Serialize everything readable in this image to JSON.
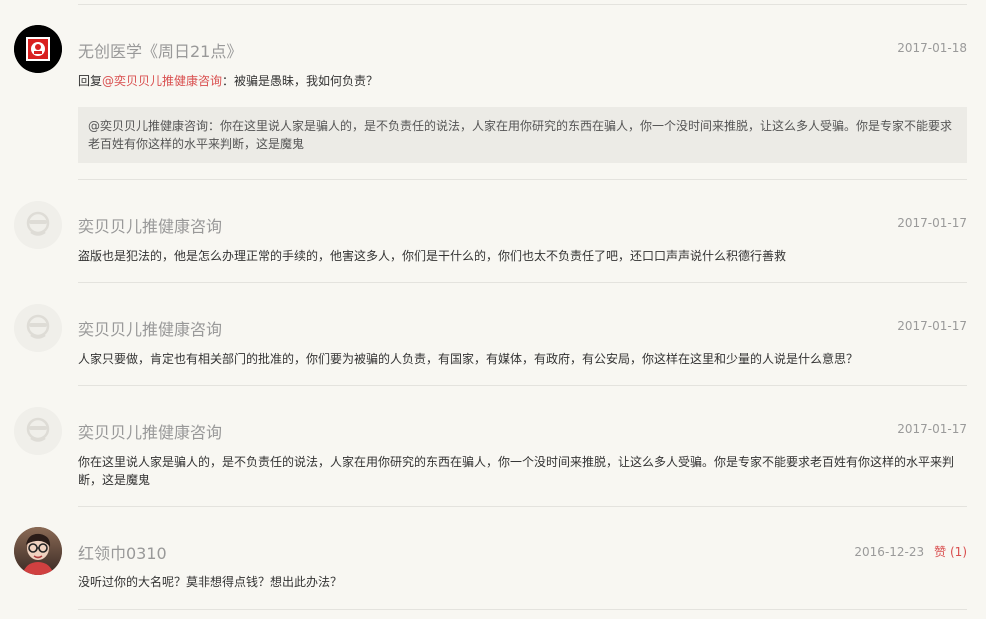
{
  "colors": {
    "background": "#f8f7f2",
    "mention": "#d94f4f",
    "muted": "#999999",
    "quote_bg": "#ecebe6"
  },
  "comments": [
    {
      "author": "无创医学《周日21点》",
      "date": "2017-01-18",
      "reply_prefix": "回复",
      "mention": "@奕贝贝儿推健康咨询",
      "reply_text": "：被骗是愚昧，我如何负责？",
      "quote": "@奕贝贝儿推健康咨询：你在这里说人家是骗人的，是不负责任的说法，人家在用你研究的东西在骗人，你一个没时间来推脱，让这么多人受骗。你是专家不能要求老百姓有你这样的水平来判断，这是魔鬼",
      "avatar": "logo-avatar-icon"
    },
    {
      "author": "奕贝贝儿推健康咨询",
      "date": "2017-01-17",
      "text": "盗版也是犯法的，他是怎么办理正常的手续的，他害这多人，你们是干什么的，你们也太不负责任了吧，还口口声声说什么积德行善救",
      "avatar": "default-user-avatar-icon"
    },
    {
      "author": "奕贝贝儿推健康咨询",
      "date": "2017-01-17",
      "text": "人家只要做，肯定也有相关部门的批准的，你们要为被骗的人负责，有国家，有媒体，有政府，有公安局，你这样在这里和少量的人说是什么意思？",
      "avatar": "default-user-avatar-icon"
    },
    {
      "author": "奕贝贝儿推健康咨询",
      "date": "2017-01-17",
      "text": "你在这里说人家是骗人的，是不负责任的说法，人家在用你研究的东西在骗人，你一个没时间来推脱，让这么多人受骗。你是专家不能要求老百姓有你这样的水平来判断，这是魔鬼",
      "avatar": "default-user-avatar-icon"
    },
    {
      "author": "红领巾0310",
      "date": "2016-12-23",
      "like_label": "赞",
      "like_count": "(1)",
      "text": "没听过你的大名呢？莫非想得点钱？想出此办法？",
      "avatar": "photo-avatar-icon"
    }
  ]
}
